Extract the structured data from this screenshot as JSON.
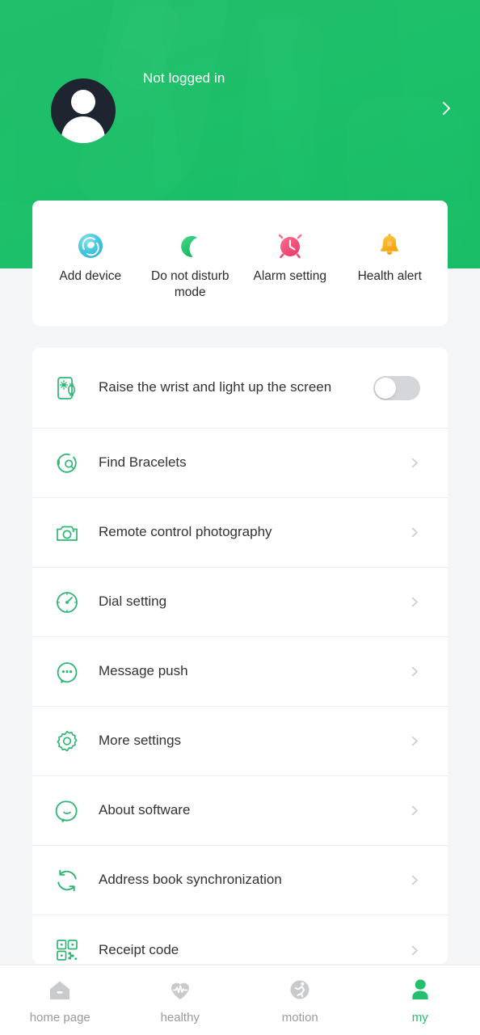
{
  "theme": {
    "accent": "#22c06a",
    "header_green": "#1fc76d",
    "page_bg": "#f4f5f7",
    "card_bg": "#ffffff",
    "label_color": "#333333",
    "muted_color": "#9a9a9a",
    "toggle_off_track": "#d4d6d9",
    "icon_green": "#2fb673",
    "avatar_bg": "#1e2430"
  },
  "header": {
    "login_status": "Not logged in",
    "avatar_icon": "user-avatar-icon",
    "chevron_icon": "chevron-right-icon"
  },
  "quick_actions": [
    {
      "label": "Add device",
      "icon": "add-device-icon",
      "color": "#3fc3d8"
    },
    {
      "label": "Do not disturb\nmode",
      "icon": "moon-icon",
      "color": "#27c06a"
    },
    {
      "label": "Alarm setting",
      "icon": "alarm-clock-icon",
      "color": "#f4547a"
    },
    {
      "label": "Health alert",
      "icon": "bell-icon",
      "color": "#f7b731"
    }
  ],
  "settings": [
    {
      "label": "Raise the wrist and light up the screen",
      "icon": "wrist-raise-screen-icon",
      "control": "toggle",
      "toggle_on": false
    },
    {
      "label": "Find Bracelets",
      "icon": "find-bracelet-icon",
      "control": "chevron"
    },
    {
      "label": "Remote control photography",
      "icon": "camera-icon",
      "control": "chevron"
    },
    {
      "label": "Dial setting",
      "icon": "watch-dial-icon",
      "control": "chevron"
    },
    {
      "label": "Message push",
      "icon": "message-bubble-icon",
      "control": "chevron"
    },
    {
      "label": "More settings",
      "icon": "gear-icon",
      "control": "chevron"
    },
    {
      "label": "About software",
      "icon": "about-smiley-icon",
      "control": "chevron"
    },
    {
      "label": "Address book synchronization",
      "icon": "sync-refresh-icon",
      "control": "chevron"
    },
    {
      "label": "Receipt code",
      "icon": "qr-code-icon",
      "control": "chevron"
    }
  ],
  "tabbar": {
    "active_index": 3,
    "tabs": [
      {
        "label": "home page",
        "icon": "home-icon"
      },
      {
        "label": "healthy",
        "icon": "heart-pulse-icon"
      },
      {
        "label": "motion",
        "icon": "runner-icon"
      },
      {
        "label": "my",
        "icon": "person-icon"
      }
    ]
  }
}
